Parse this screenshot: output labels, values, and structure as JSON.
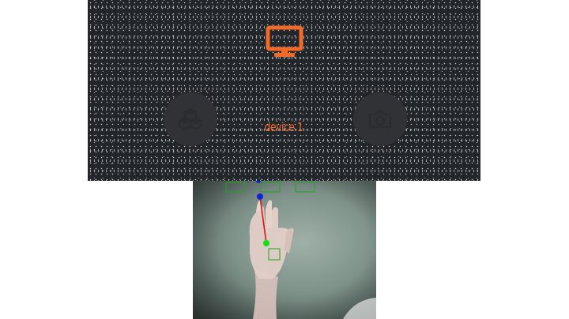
{
  "device_panel": {
    "device_label": "device 1",
    "icons": {
      "center": "monitor-icon",
      "left_button": "cubes-icon",
      "right_button": "camera-icon"
    },
    "colors": {
      "accent": "#f26a2a",
      "panel_background": "#22262a",
      "button_background": "#303235"
    }
  },
  "camera_feed": {
    "description_icon": "hand-tracking-overlay",
    "colors": {
      "skeleton_line": "#e01010",
      "keypoint_top": "#1020e0",
      "keypoint_palm": "#10e010",
      "detection_boxes": "#1fa31f"
    }
  }
}
